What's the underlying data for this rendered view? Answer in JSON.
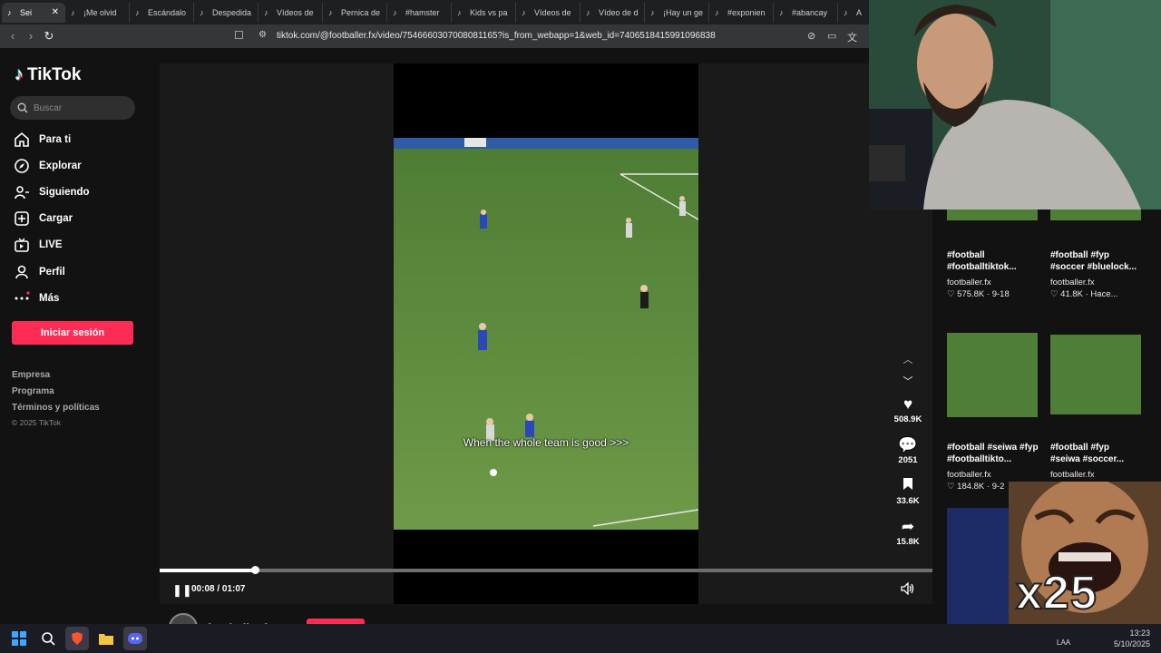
{
  "browser": {
    "tabs": [
      {
        "label": "Sei",
        "active": true
      },
      {
        "label": "¡Me olvid"
      },
      {
        "label": "Escándalo"
      },
      {
        "label": "Despedida"
      },
      {
        "label": "Vídeos de"
      },
      {
        "label": "Pernica de"
      },
      {
        "label": "#hamster"
      },
      {
        "label": "Kids vs pa"
      },
      {
        "label": "Vídeos de"
      },
      {
        "label": "Vídeo de d"
      },
      {
        "label": "¡Hay un ge"
      },
      {
        "label": "#exponien"
      },
      {
        "label": "#abancay"
      },
      {
        "label": "A"
      }
    ],
    "url": "tiktok.com/@footballer.fx/video/7546660307008081165?is_from_webapp=1&web_id=7406518415991096838"
  },
  "sidebar": {
    "logo": "TikTok",
    "search_placeholder": "Buscar",
    "nav": [
      {
        "label": "Para ti",
        "icon": "home-icon"
      },
      {
        "label": "Explorar",
        "icon": "compass-icon"
      },
      {
        "label": "Siguiendo",
        "icon": "following-icon"
      },
      {
        "label": "Cargar",
        "icon": "upload-icon"
      },
      {
        "label": "LIVE",
        "icon": "live-icon"
      },
      {
        "label": "Perfil",
        "icon": "profile-icon"
      },
      {
        "label": "Más",
        "icon": "more-icon"
      }
    ],
    "login": "Iniciar sesión",
    "footer": [
      "Empresa",
      "Programa",
      "Términos y políticas"
    ],
    "copyright": "© 2025 TikTok"
  },
  "video": {
    "caption": "When the whole team is good >>>",
    "time": "00:08 / 01:07",
    "progress": 0.123,
    "author": "footballer.fx"
  },
  "actions": {
    "likes": "508.9K",
    "comments": "2051",
    "saves": "33.6K",
    "shares": "15.8K"
  },
  "related": [
    {
      "title": "#football #footballtiktok...",
      "user": "footballer.fx",
      "meta": "575.8K · 9-18"
    },
    {
      "title": "#football #fyp #soccer #bluelock...",
      "user": "footballer.fx",
      "meta": "41.8K · Hace..."
    },
    {
      "title": "#football #seiwa #fyp #footballtikto...",
      "user": "footballer.fx",
      "meta": "184.8K · 9-2"
    },
    {
      "title": "#football #fyp #seiwa #soccer...",
      "user": "footballer.fx",
      "meta": ""
    }
  ],
  "overlay": {
    "emote_text": "x25"
  },
  "taskbar": {
    "time": "13:23",
    "date": "5/10/2025",
    "lang": "LAA"
  }
}
